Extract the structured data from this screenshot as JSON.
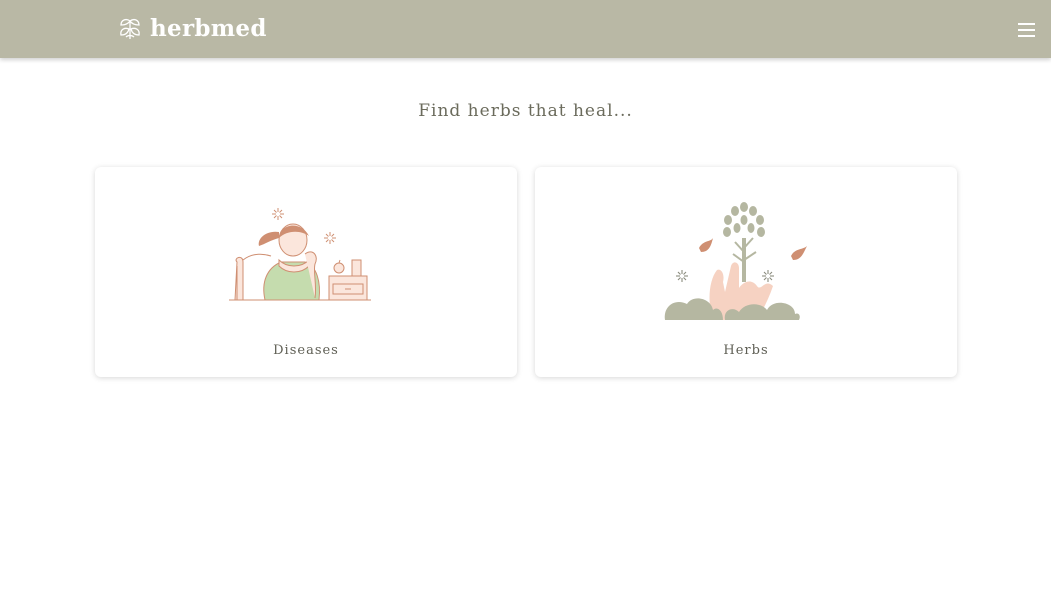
{
  "app": {
    "brand_name": "herbmed",
    "brand_icon": "leaf-logo-icon",
    "menu_icon": "hamburger-menu-icon"
  },
  "main": {
    "title": "Find herbs that heal...",
    "cards": [
      {
        "label": "Diseases",
        "illustration": "sick-woman-illustration"
      },
      {
        "label": "Herbs",
        "illustration": "hand-holding-tree-illustration"
      }
    ]
  },
  "colors": {
    "navbar": "#b9b8a5",
    "sage": "#b5b7a1",
    "green": "#c5dcae",
    "terracotta": "#cf8f72",
    "skin": "#f6d2c2",
    "text": "#6b6b5c"
  }
}
